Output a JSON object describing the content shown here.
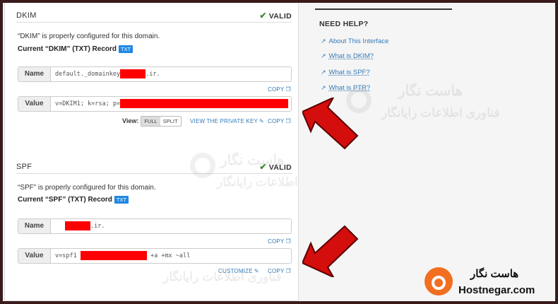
{
  "dkim": {
    "title": "DKIM",
    "status": "VALID",
    "description": "“DKIM” is properly configured for this domain.",
    "current_prefix": "Current “DKIM” (TXT) Record",
    "badge": "TXT",
    "name_label": "Name",
    "name_prefix": "default._domainkey",
    "name_suffix": ".ir.",
    "copy_label": "COPY",
    "value_label": "Value",
    "value_prefix": "v=DKIM1; k=rsa; p=",
    "view_label": "View:",
    "view_full": "FULL",
    "view_split": "SPLIT",
    "view_private_key": "VIEW THE PRIVATE KEY"
  },
  "spf": {
    "title": "SPF",
    "status": "VALID",
    "description": "“SPF” is properly configured for this domain.",
    "current_prefix": "Current “SPF” (TXT) Record",
    "badge": "TXT",
    "name_label": "Name",
    "name_suffix": ".ir.",
    "copy_label": "COPY",
    "value_label": "Value",
    "value_prefix": "v=spf1",
    "value_suffix": "+a +mx ~all",
    "customize_label": "CUSTOMIZE"
  },
  "help": {
    "title": "NEED HELP?",
    "links": [
      {
        "text": "About This Interface",
        "underlined": false
      },
      {
        "text": "What is DKIM?",
        "underlined": true
      },
      {
        "text": "What is SPF?",
        "underlined": true
      },
      {
        "text": "What is PTR?",
        "underlined": true
      }
    ]
  },
  "watermark": {
    "fa_name": "هاست نگار",
    "fa_tagline": "فناوری اطلاعات رایانگار",
    "logo_en": "Hostnegar.com"
  },
  "colors": {
    "accent": "#337ab7",
    "valid": "#3c8a2e",
    "redact": "#ff0000",
    "brand": "#f26f21"
  }
}
